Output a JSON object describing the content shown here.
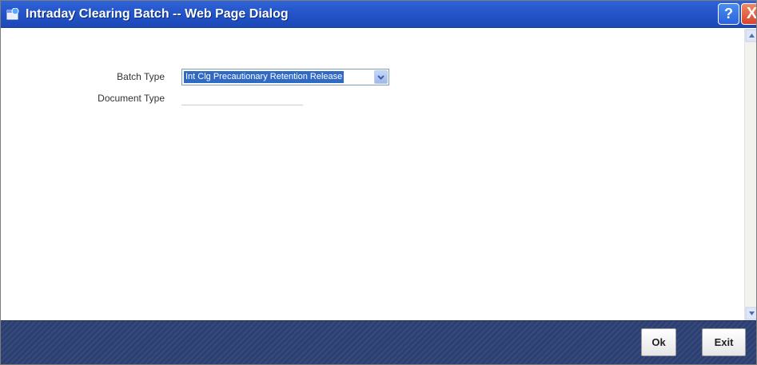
{
  "window": {
    "title": "Intraday Clearing Batch -- Web Page Dialog",
    "help_label": "?",
    "close_label": "X"
  },
  "form": {
    "batch_type_label": "Batch Type",
    "batch_type_value": "Int Clg Precautionary Retention Release",
    "document_type_label": "Document Type",
    "document_type_value": ""
  },
  "footer": {
    "ok_label": "Ok",
    "exit_label": "Exit"
  },
  "colors": {
    "titlebar": "#2455c9",
    "footer": "#2b3f72",
    "selection": "#316ac5"
  }
}
